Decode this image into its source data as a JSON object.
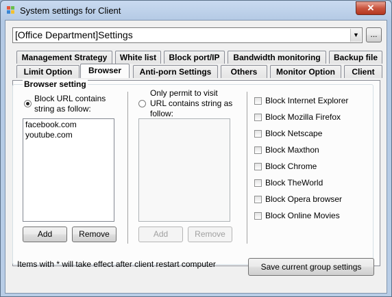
{
  "window": {
    "title": "System settings for Client",
    "close_glyph": "✕"
  },
  "group_select": {
    "value": "[Office Department]Settings",
    "arrow_glyph": "▼",
    "browse_label": "..."
  },
  "tabs": {
    "row1": [
      "Management Strategy",
      "White list",
      "Block port/IP",
      "Bandwidth monitoring",
      "Backup file"
    ],
    "row2": [
      "Limit Option",
      "Browser",
      "Anti-porn Settings",
      "Others",
      "Monitor Option",
      "Client"
    ],
    "active": "Browser"
  },
  "browser": {
    "group_title": "Browser setting",
    "block_mode_label": "Block URL contains string as follow:",
    "block_mode_selected": true,
    "block_list": [
      "facebook.com",
      "youtube.com"
    ],
    "permit_mode_label": "Only permit to visit URL contains string as follow:",
    "permit_mode_selected": false,
    "permit_list": [],
    "add_label": "Add",
    "remove_label": "Remove",
    "browsers": [
      {
        "label": "Block Internet Explorer",
        "checked": false
      },
      {
        "label": "Block Mozilla Firefox",
        "checked": false
      },
      {
        "label": "Block Netscape",
        "checked": false
      },
      {
        "label": "Block Maxthon",
        "checked": false
      },
      {
        "label": "Block Chrome",
        "checked": false
      },
      {
        "label": "Block TheWorld",
        "checked": false
      },
      {
        "label": "Block Opera browser",
        "checked": false
      },
      {
        "label": "Block Online Movies",
        "checked": false
      }
    ]
  },
  "footer": {
    "note": "Items with * will take effect after client restart computer",
    "save_label": "Save current group settings"
  }
}
